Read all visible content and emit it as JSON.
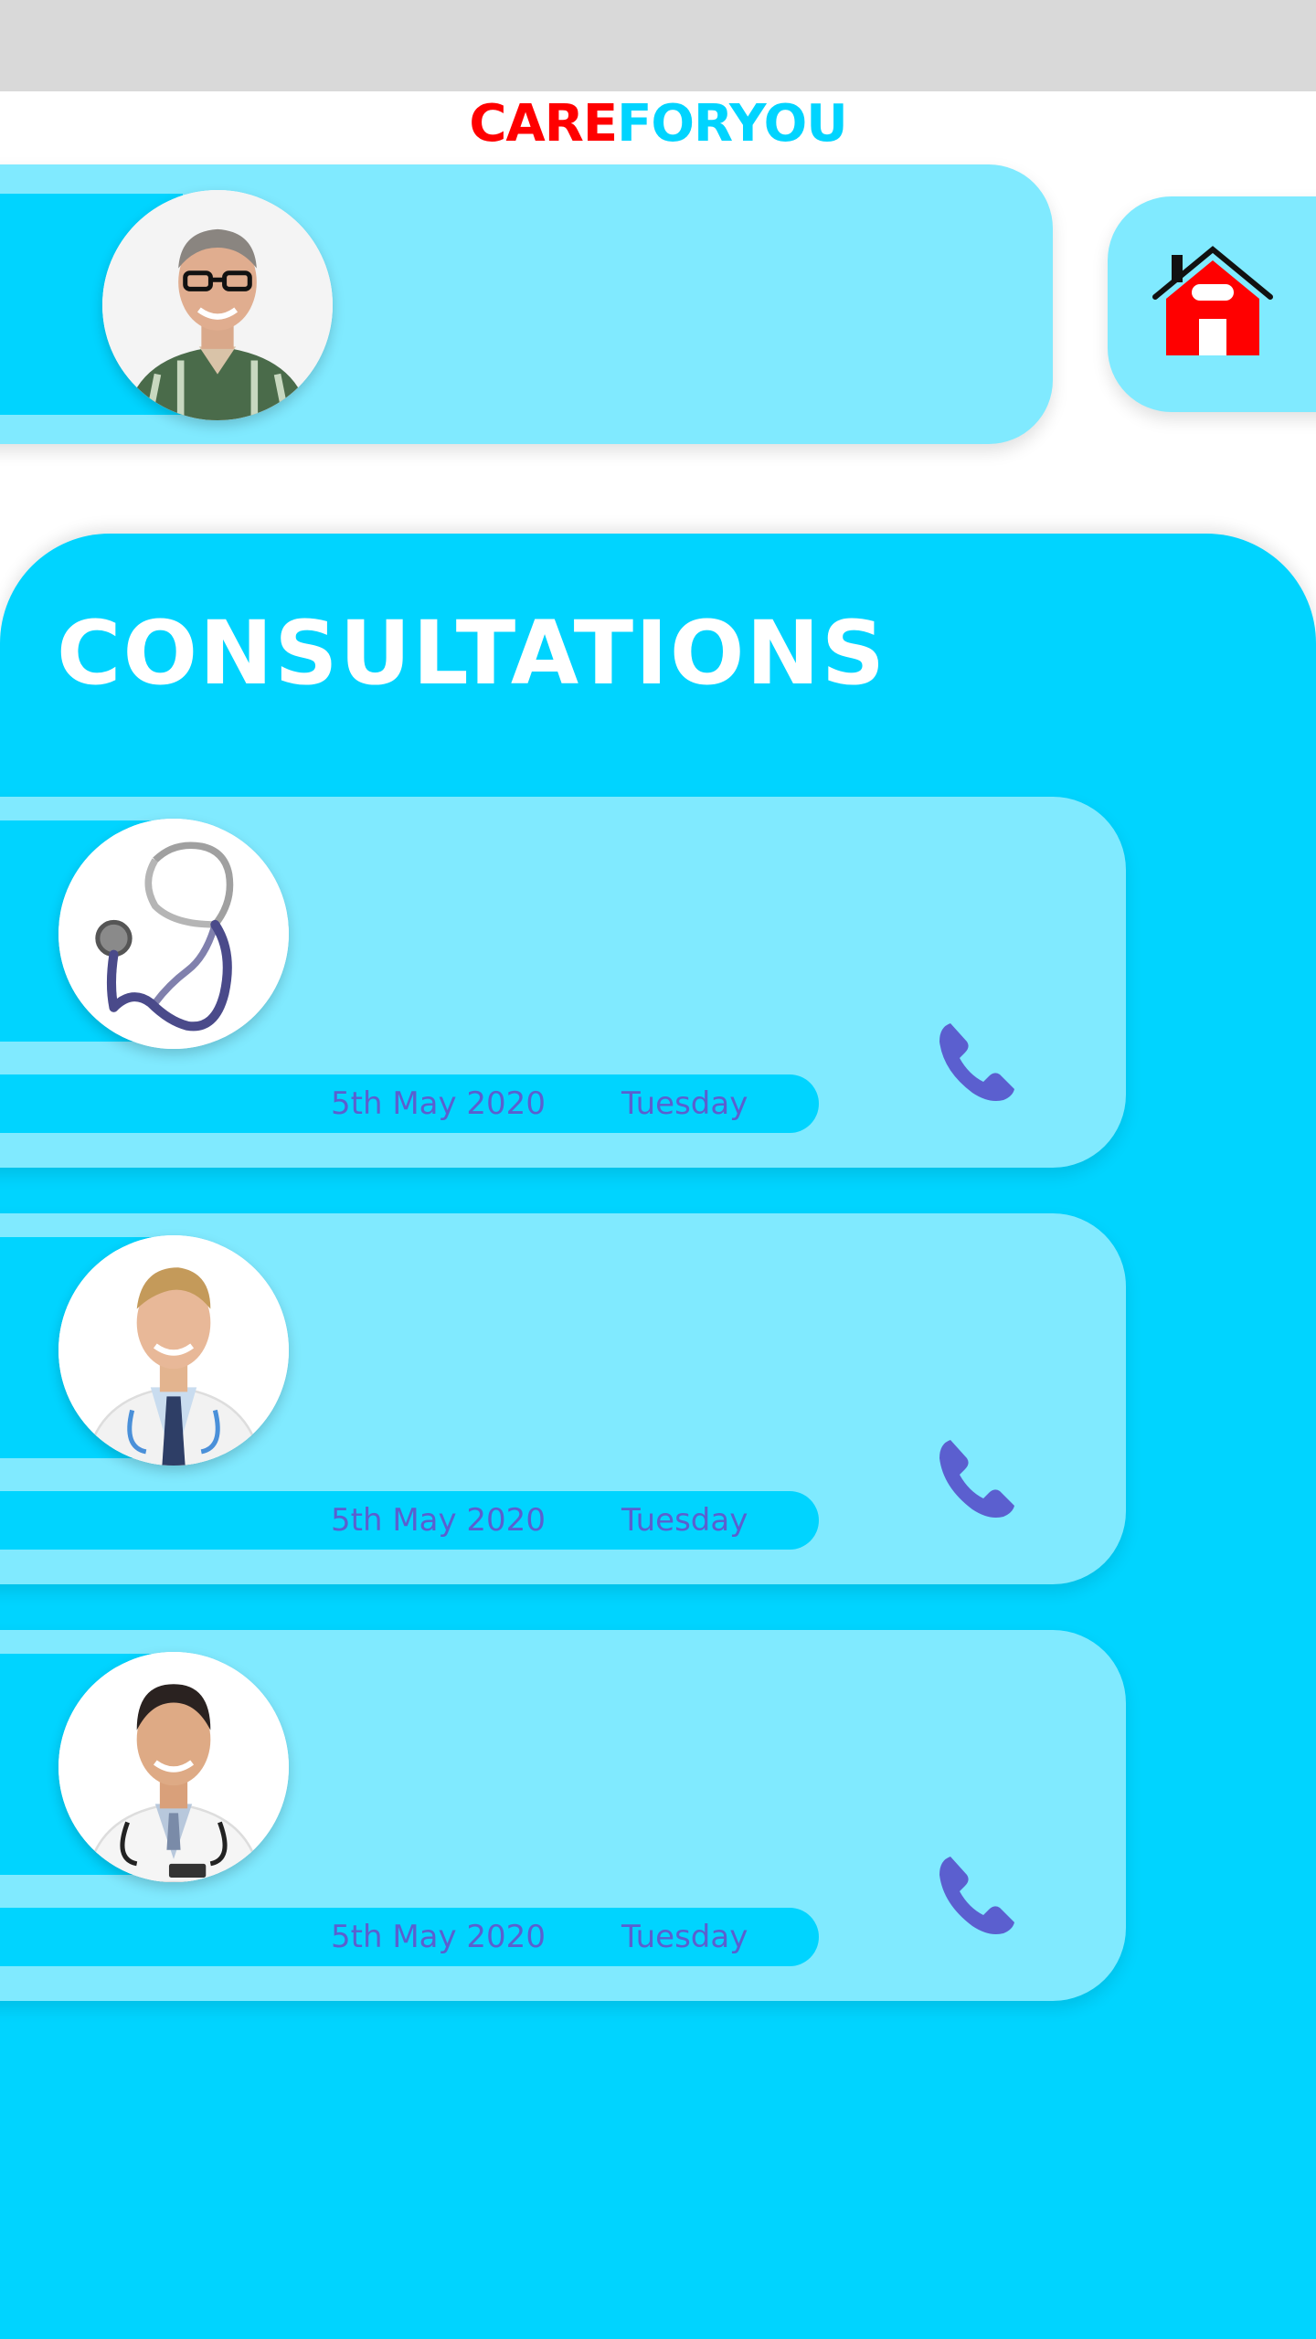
{
  "brand": {
    "part1": "CARE",
    "part2": "FORYOU"
  },
  "profile": {
    "avatar_icon": "user-avatar-icon"
  },
  "home": {
    "icon": "home-icon",
    "color": "#ff0000"
  },
  "consultations": {
    "title": "CONSULTATIONS",
    "items": [
      {
        "avatar_icon": "stethoscope-icon",
        "date": "5th May 2020",
        "day": "Tuesday",
        "action_icon": "phone-icon"
      },
      {
        "avatar_icon": "doctor-avatar-icon",
        "date": "5th May 2020",
        "day": "Tuesday",
        "action_icon": "phone-icon"
      },
      {
        "avatar_icon": "doctor-avatar-icon",
        "date": "5th May 2020",
        "day": "Tuesday",
        "action_icon": "phone-icon"
      }
    ]
  },
  "colors": {
    "accent": "#00d4ff",
    "card": "#80eaff",
    "brand_red": "#ff0000",
    "text_purple": "#5b5fcf"
  }
}
